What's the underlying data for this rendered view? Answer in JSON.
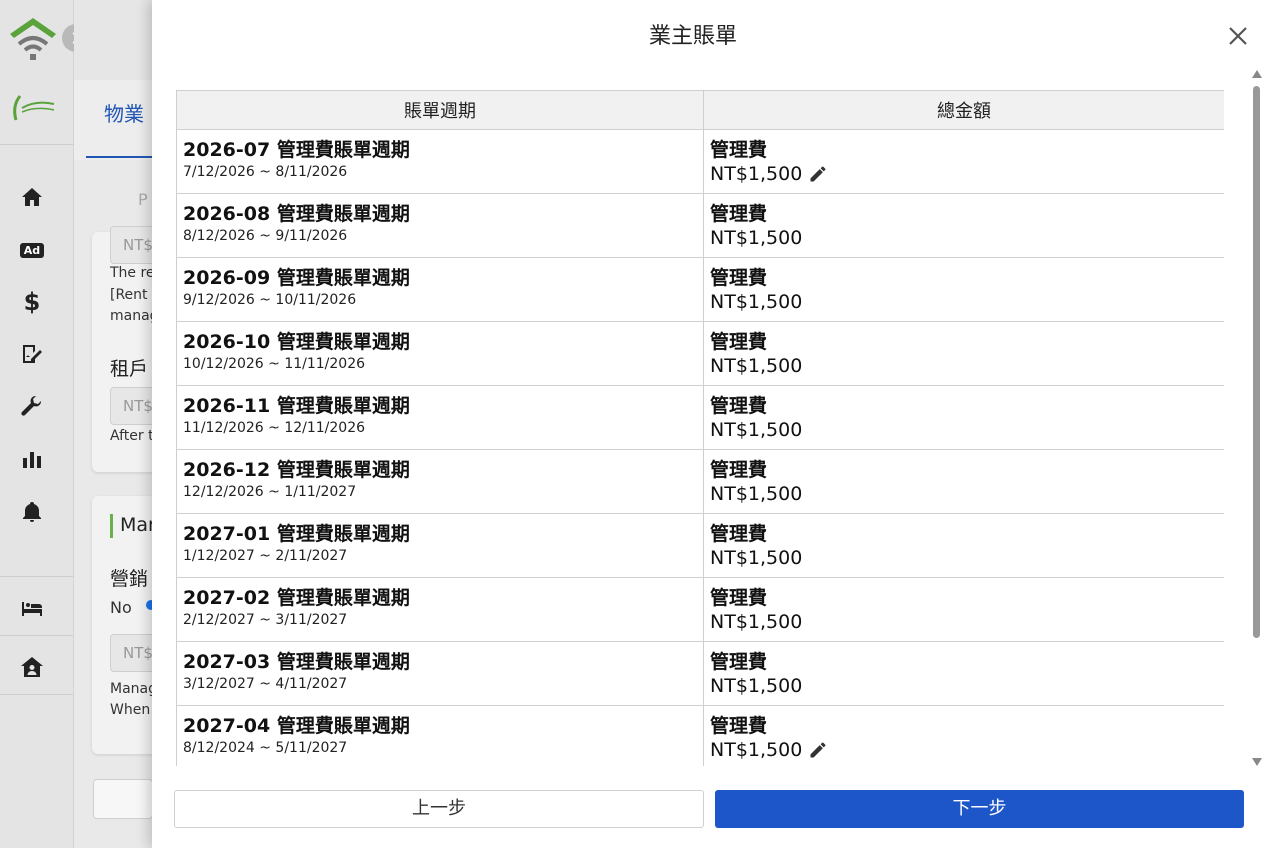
{
  "background": {
    "tab_label": "物業",
    "tenant_label": "租戶",
    "marketing_label": "營銷",
    "mar_label": "Mar",
    "no_label": "No",
    "input_placeholder": "NT$",
    "p_label": "P",
    "text_refund": "The ref",
    "text_rent": "[Rent b",
    "text_manag": "manag",
    "text_after": "After th",
    "text_manag2": "Manag",
    "text_when": "When"
  },
  "modal": {
    "title": "業主賬單",
    "columns": [
      "賬單週期",
      "總金額"
    ],
    "rows": [
      {
        "period": "2026-07 管理費賬單週期",
        "range": "7/12/2026 ~ 8/11/2026",
        "fee": "管理費",
        "amount": "NT$1,500",
        "editable": true
      },
      {
        "period": "2026-08 管理費賬單週期",
        "range": "8/12/2026 ~ 9/11/2026",
        "fee": "管理費",
        "amount": "NT$1,500",
        "editable": false
      },
      {
        "period": "2026-09 管理費賬單週期",
        "range": "9/12/2026 ~ 10/11/2026",
        "fee": "管理費",
        "amount": "NT$1,500",
        "editable": false
      },
      {
        "period": "2026-10 管理費賬單週期",
        "range": "10/12/2026 ~ 11/11/2026",
        "fee": "管理費",
        "amount": "NT$1,500",
        "editable": false
      },
      {
        "period": "2026-11 管理費賬單週期",
        "range": "11/12/2026 ~ 12/11/2026",
        "fee": "管理費",
        "amount": "NT$1,500",
        "editable": false
      },
      {
        "period": "2026-12 管理費賬單週期",
        "range": "12/12/2026 ~ 1/11/2027",
        "fee": "管理費",
        "amount": "NT$1,500",
        "editable": false
      },
      {
        "period": "2027-01 管理費賬單週期",
        "range": "1/12/2027 ~ 2/11/2027",
        "fee": "管理費",
        "amount": "NT$1,500",
        "editable": false
      },
      {
        "period": "2027-02 管理費賬單週期",
        "range": "2/12/2027 ~ 3/11/2027",
        "fee": "管理費",
        "amount": "NT$1,500",
        "editable": false
      },
      {
        "period": "2027-03 管理費賬單週期",
        "range": "3/12/2027 ~ 4/11/2027",
        "fee": "管理費",
        "amount": "NT$1,500",
        "editable": false
      },
      {
        "period": "2027-04 管理費賬單週期",
        "range": "8/12/2024 ~ 5/11/2027",
        "fee": "管理費",
        "amount": "NT$1,500",
        "editable": true
      }
    ],
    "prev_label": "上一步",
    "next_label": "下一步"
  },
  "sidebar": {
    "icons": [
      "home-icon",
      "ad-icon",
      "dollar-icon",
      "contract-icon",
      "wrench-icon",
      "chart-icon",
      "bell-icon",
      "bed-icon",
      "house-user-icon"
    ],
    "ad_text": "Ad",
    "dollar_text": "$"
  },
  "colors": {
    "accent": "#1c56c9",
    "tab_blue": "#2256b5",
    "logo_green": "#5aa33a"
  }
}
